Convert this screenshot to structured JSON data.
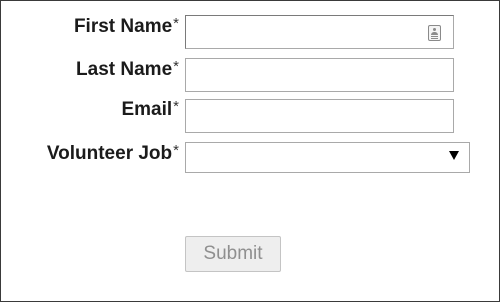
{
  "form": {
    "fields": [
      {
        "label": "First Name",
        "required_mark": "*",
        "value": ""
      },
      {
        "label": "Last Name",
        "required_mark": "*",
        "value": ""
      },
      {
        "label": "Email",
        "required_mark": "*",
        "value": ""
      }
    ],
    "volunteer_job": {
      "label": "Volunteer Job",
      "required_mark": "*",
      "selected": ""
    },
    "submit_label": "Submit",
    "submit_disabled": true
  },
  "icons": {
    "autofill": "contact-card-icon",
    "dropdown": "dropdown-arrow-icon"
  },
  "colors": {
    "label_text": "#1b1b1b",
    "border": "#a9a9a9",
    "button_bg": "#eeeeee",
    "button_text": "#8f8f8f"
  }
}
